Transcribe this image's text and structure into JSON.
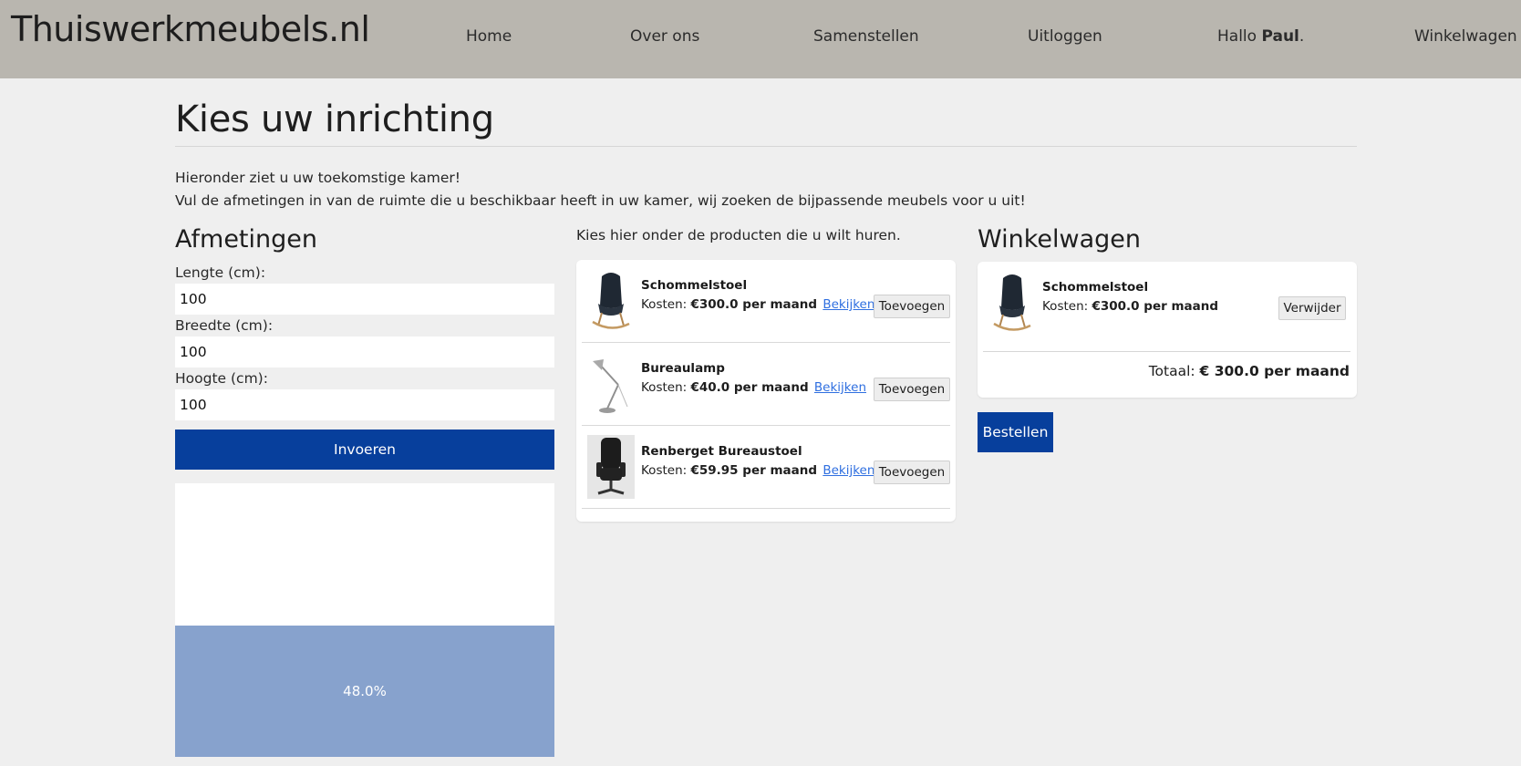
{
  "header": {
    "brand": "Thuiswerkmeubels.nl",
    "nav": {
      "home": "Home",
      "about": "Over ons",
      "compose": "Samenstellen",
      "logout": "Uitloggen",
      "greeting_prefix": "Hallo",
      "user_name": "Paul",
      "greeting_suffix": ".",
      "cart": "Winkelwagen"
    }
  },
  "page": {
    "title": "Kies uw inrichting",
    "intro_line1": "Hieronder ziet u uw toekomstige kamer!",
    "intro_line2": "Vul de afmetingen in van de ruimte die u beschikbaar heeft in uw kamer, wij zoeken de bijpassende meubels voor u uit!"
  },
  "dimensions": {
    "heading": "Afmetingen",
    "length_label": "Lengte (cm):",
    "length_value": "100",
    "width_label": "Breedte (cm):",
    "width_value": "100",
    "height_label": "Hoogte (cm):",
    "height_value": "100",
    "submit_label": "Invoeren",
    "fill_text": "48.0%",
    "fill_fraction": 0.48
  },
  "products": {
    "hint": "Kies hier onder de producten die u wilt huren.",
    "cost_prefix": "Kosten:",
    "view_label": "Bekijken",
    "add_label": "Toevoegen",
    "items": [
      {
        "name": "Schommelstoel",
        "price": "€300.0 per maand",
        "icon": "rocking-chair-icon"
      },
      {
        "name": "Bureaulamp",
        "price": "€40.0 per maand",
        "icon": "desk-lamp-icon"
      },
      {
        "name": "Renberget Bureaustoel",
        "price": "€59.95 per maand",
        "icon": "office-chair-icon"
      }
    ]
  },
  "cart": {
    "heading": "Winkelwagen",
    "items": [
      {
        "name": "Schommelstoel",
        "price": "€300.0 per maand",
        "icon": "rocking-chair-icon"
      }
    ],
    "remove_label": "Verwijder",
    "total_label": "Totaal:",
    "total_value": "€ 300.0 per maand",
    "order_label": "Bestellen"
  },
  "colors": {
    "header_bg": "#b9b6af",
    "page_bg": "#efefef",
    "primary": "#073f9c",
    "room_fill": "#87a2cd",
    "link": "#2f6fe0"
  }
}
